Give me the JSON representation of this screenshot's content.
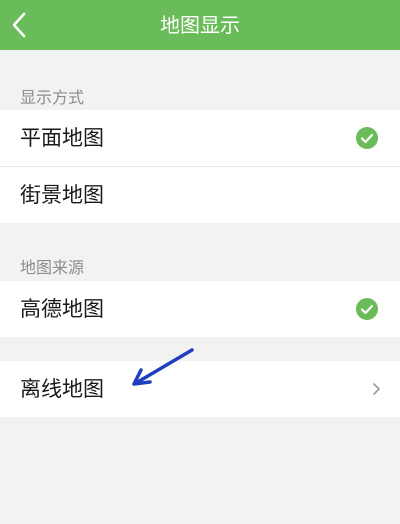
{
  "header": {
    "title": "地图显示",
    "back_icon": "chevron-left-icon"
  },
  "sections": [
    {
      "label": "显示方式",
      "items": [
        {
          "label": "平面地图",
          "selected": true
        },
        {
          "label": "街景地图",
          "selected": false
        }
      ]
    },
    {
      "label": "地图来源",
      "items": [
        {
          "label": "高德地图",
          "selected": true
        }
      ]
    }
  ],
  "offline": {
    "label": "离线地图",
    "icon": "chevron-right-icon"
  },
  "colors": {
    "accent": "#6abb5a",
    "annotation_arrow": "#1f3fbf"
  }
}
